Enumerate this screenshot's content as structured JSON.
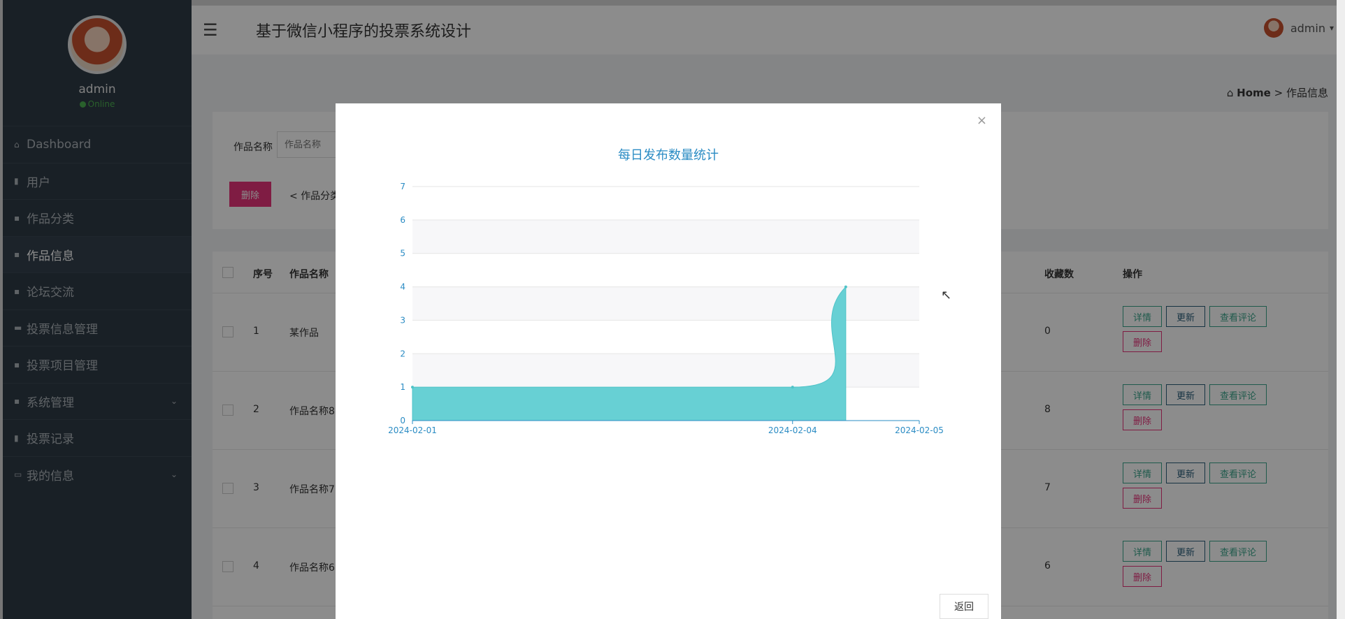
{
  "sidebar": {
    "username": "admin",
    "status": "Online",
    "menu": [
      {
        "label": "Dashboard",
        "icon": "home-icon"
      },
      {
        "label": "用户",
        "icon": "users-icon"
      },
      {
        "label": "作品分类",
        "icon": "grid-icon"
      },
      {
        "label": "作品信息",
        "icon": "grid-icon",
        "active": true
      },
      {
        "label": "论坛交流",
        "icon": "grid-icon"
      },
      {
        "label": "投票信息管理",
        "icon": "ticket-icon"
      },
      {
        "label": "投票项目管理",
        "icon": "grid-icon"
      },
      {
        "label": "系统管理",
        "icon": "grid-icon",
        "expandable": true
      },
      {
        "label": "投票记录",
        "icon": "bar-chart-icon"
      },
      {
        "label": "我的信息",
        "icon": "profile-icon",
        "expandable": true
      }
    ]
  },
  "header": {
    "menu_icon": "☰",
    "title": "基于微信小程序的投票系统设计",
    "user": "admin"
  },
  "breadcrumb": {
    "home": "Home",
    "separator": ">",
    "current": "作品信息"
  },
  "search": {
    "label": "作品名称",
    "placeholder": "作品名称",
    "delete_label": "删除",
    "share_label": "作品分类"
  },
  "table": {
    "headers": {
      "seq": "序号",
      "name": "作品名称",
      "favorites": "收藏数",
      "ops": "操作"
    },
    "rows": [
      {
        "seq": "1",
        "name": "某作品",
        "favorites": "0"
      },
      {
        "seq": "2",
        "name": "作品名称8",
        "favorites": "8"
      },
      {
        "seq": "3",
        "name": "作品名称7",
        "favorites": "7"
      },
      {
        "seq": "4",
        "name": "作品名称6",
        "favorites": "6"
      }
    ],
    "buttons": {
      "detail": "详情",
      "update": "更新",
      "comments": "查看评论",
      "delete": "删除"
    }
  },
  "modal": {
    "close": "×",
    "back_label": "返回"
  },
  "colors": {
    "accent": "#2b8cc4",
    "area": "#67d0d4",
    "danger": "#e8337a",
    "sidebar": "#2f3b46"
  },
  "chart_data": {
    "type": "area",
    "title": "每日发布数量统计",
    "x_ticks": [
      "2024-02-01",
      "2024-02-04",
      "2024-02-05"
    ],
    "x": [
      "2024-02-01",
      "2024-02-04",
      "2024-02-05"
    ],
    "values": [
      1,
      1,
      4
    ],
    "ylim": [
      0,
      7
    ],
    "y_ticks": [
      0,
      1,
      2,
      3,
      4,
      5,
      6,
      7
    ],
    "grid": true,
    "smooth": true,
    "xlabel": "",
    "ylabel": ""
  }
}
